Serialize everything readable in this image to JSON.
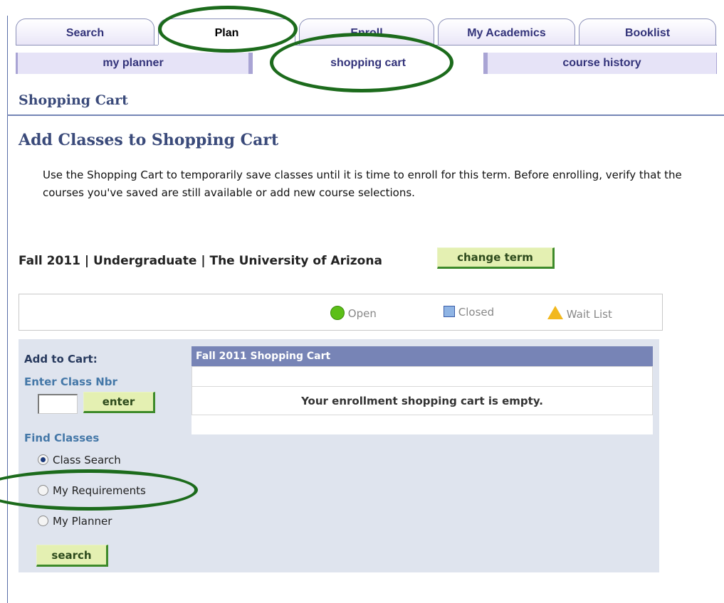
{
  "tabs": [
    "Search",
    "Plan",
    "Enroll",
    "My Academics",
    "Booklist"
  ],
  "subtabs": [
    "my planner",
    "shopping cart",
    "course history"
  ],
  "page_heading": "Shopping Cart",
  "section_heading": "Add Classes to Shopping Cart",
  "intro_text": "Use the Shopping Cart to temporarily save classes until it is time to enroll for this term. Before enrolling, verify that the courses you've saved are still available or add new course selections.",
  "term_info": "Fall 2011 | Undergraduate | The University of Arizona",
  "change_term_label": "change term",
  "legend": {
    "open": "Open",
    "closed": "Closed",
    "wait_list": "Wait List"
  },
  "add_to_cart": {
    "label": "Add to Cart:",
    "enter_class_nbr_label": "Enter Class Nbr",
    "class_nbr_value": "",
    "enter_button": "enter",
    "find_classes_label": "Find Classes",
    "options": [
      "Class Search",
      "My Requirements",
      "My Planner"
    ],
    "selected": "Class Search",
    "search_button": "search"
  },
  "cart": {
    "title": "Fall 2011 Shopping Cart",
    "empty_message": "Your enrollment shopping cart is empty."
  },
  "colors": {
    "tab_text": "#33337a",
    "heading": "#3a4a7a",
    "button_bg": "#e4f0b2",
    "button_border": "#3d8a2a",
    "panel_bg": "#dfe4ee",
    "cart_header": "#7784b6",
    "annotation": "#1c6b1c"
  }
}
